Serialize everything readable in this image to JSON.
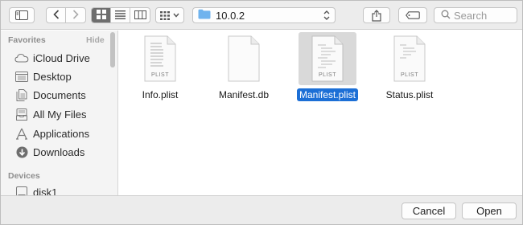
{
  "toolbar": {
    "path_label": "10.0.2",
    "search_placeholder": "Search"
  },
  "sidebar": {
    "favorites_header": "Favorites",
    "hide_label": "Hide",
    "favorites": [
      {
        "label": "iCloud Drive",
        "icon": "cloud-icon"
      },
      {
        "label": "Desktop",
        "icon": "desktop-icon"
      },
      {
        "label": "Documents",
        "icon": "documents-icon"
      },
      {
        "label": "All My Files",
        "icon": "all-files-icon"
      },
      {
        "label": "Applications",
        "icon": "applications-icon"
      },
      {
        "label": "Downloads",
        "icon": "downloads-icon"
      }
    ],
    "devices_header": "Devices",
    "devices": [
      {
        "label": "disk1",
        "icon": "disk-icon"
      }
    ]
  },
  "files": [
    {
      "name": "Info.plist",
      "badge": "PLIST",
      "selected": false
    },
    {
      "name": "Manifest.db",
      "badge": "",
      "selected": false
    },
    {
      "name": "Manifest.plist",
      "badge": "PLIST",
      "selected": true
    },
    {
      "name": "Status.plist",
      "badge": "PLIST",
      "selected": false
    }
  ],
  "buttons": {
    "cancel": "Cancel",
    "open": "Open"
  },
  "colors": {
    "selection": "#1c6fd6",
    "folder": "#6fb3ee"
  }
}
